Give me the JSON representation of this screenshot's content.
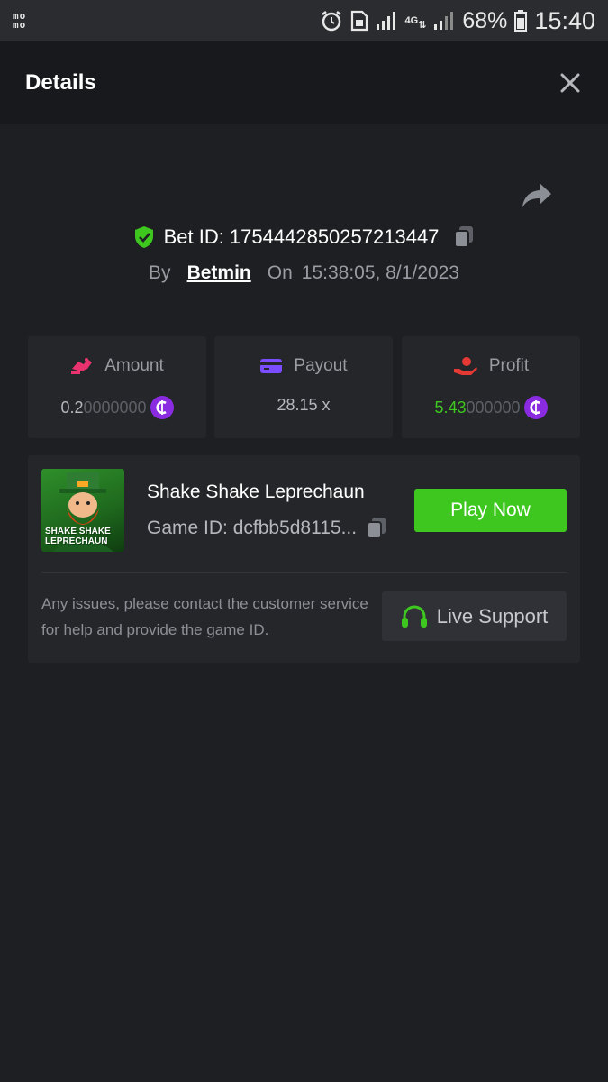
{
  "status_bar": {
    "carrier_logo": "mo\nmo",
    "network": "4G",
    "battery_pct": "68%",
    "time": "15:40",
    "icons": [
      "alarm-icon",
      "sim-icon",
      "signal-icon",
      "network-4g-icon",
      "signal-icon",
      "battery-icon"
    ]
  },
  "header": {
    "title": "Details",
    "close_icon": "close-icon"
  },
  "bet": {
    "id_label": "Bet ID: 1754442850257213447",
    "by_label": "By",
    "user": "Betmin",
    "on_label": "On",
    "time": "15:38:05, 8/1/2023"
  },
  "stats": {
    "amount": {
      "label": "Amount",
      "value_main": "0.2",
      "value_dim": "0000000",
      "icon": "amount-icon"
    },
    "payout": {
      "label": "Payout",
      "value": "28.15 x",
      "icon": "payout-icon"
    },
    "profit": {
      "label": "Profit",
      "value_main": "5.43",
      "value_dim": "000000",
      "icon": "profit-icon"
    }
  },
  "game": {
    "thumb_text": "SHAKE SHAKE LEPRECHAUN",
    "name": "Shake Shake Leprechaun",
    "id_label": "Game ID: dcfbb5d8115...",
    "play_label": "Play Now",
    "support_text": "Any issues, please contact the customer service for help and provide the game ID.",
    "support_label": "Live Support"
  },
  "colors": {
    "background": "#1e1f22",
    "card": "#25262a",
    "accent_green": "#3dc71f",
    "coin_purple": "#8a2be2",
    "amount_pink": "#e8336e",
    "payout_purple": "#7c4dff",
    "profit_red": "#e53935"
  }
}
